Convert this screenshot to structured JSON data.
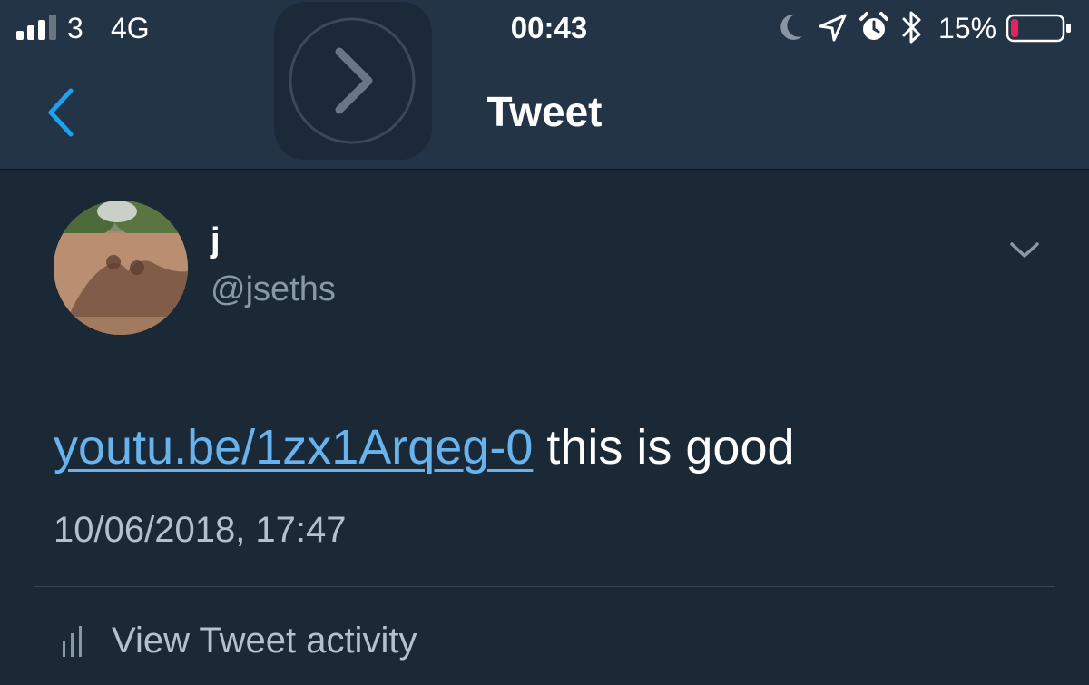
{
  "status_bar": {
    "carrier": "3",
    "network": "4G",
    "time": "00:43",
    "battery_percent": "15%",
    "signal_bars": 3,
    "battery_level": 0.15,
    "icons": [
      "signal-icon",
      "moon-icon",
      "location-arrow-icon",
      "alarm-clock-icon",
      "bluetooth-icon",
      "battery-icon"
    ]
  },
  "header": {
    "title": "Tweet",
    "back_icon": "chevron-left-icon"
  },
  "tweet": {
    "display_name": "j",
    "handle": "@jseths",
    "link_text": "youtu.be/1zx1Arqeg-0",
    "body_text": " this is good",
    "timestamp": "10/06/2018, 17:47",
    "menu_icon": "chevron-down-icon"
  },
  "activity": {
    "label": "View Tweet activity",
    "icon": "bar-chart-icon"
  },
  "colors": {
    "header_bg": "#243447",
    "body_bg": "#1b2836",
    "link": "#68b3ee",
    "accent": "#1da1f2",
    "muted": "#8899a6",
    "battery_low": "#e0245e"
  }
}
